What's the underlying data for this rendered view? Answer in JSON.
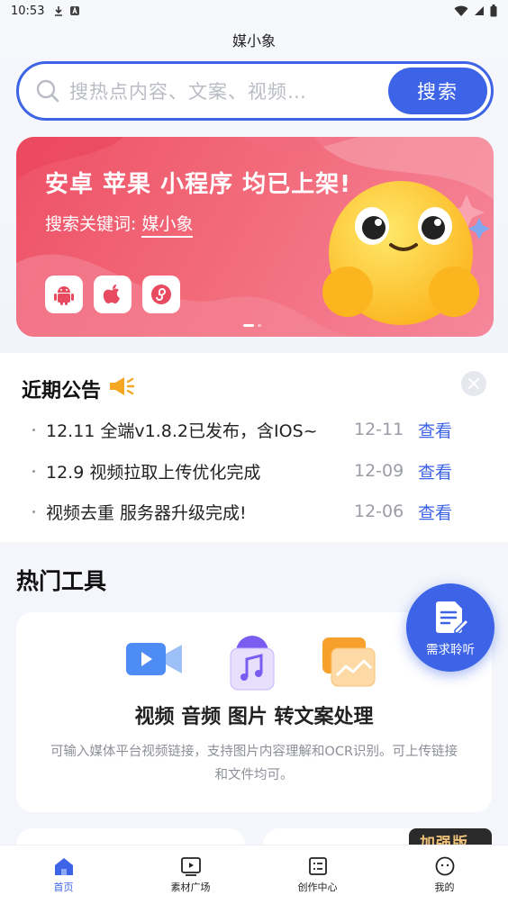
{
  "status_bar": {
    "time": "10:53"
  },
  "header": {
    "title": "媒小象"
  },
  "search": {
    "placeholder": "搜热点内容、文案、视频…",
    "button_label": "搜索"
  },
  "banner": {
    "title": "安卓 苹果 小程序 均已上架!",
    "subtitle_prefix": "搜索关键词:",
    "keyword": "媒小象",
    "platform_icons": [
      "android-icon",
      "apple-icon",
      "mini-program-icon"
    ]
  },
  "announcements": {
    "title": "近期公告",
    "items": [
      {
        "text": "12.11 全端v1.8.2已发布，含IOS~",
        "date": "12-11",
        "action": "查看"
      },
      {
        "text": "12.9 视频拉取上传优化完成",
        "date": "12-09",
        "action": "查看"
      },
      {
        "text": "视频去重 服务器升级完成!",
        "date": "12-06",
        "action": "查看"
      }
    ]
  },
  "hot_tools": {
    "title": "热门工具",
    "card_title": "视频 音频 图片 转文案处理",
    "card_desc": "可输入媒体平台视频链接，支持图片内容理解和OCR识别。可上传链接和文件均可。",
    "peek_badge": "加强版"
  },
  "fab": {
    "label": "需求聆听"
  },
  "bottom_nav": {
    "items": [
      {
        "label": "首页",
        "icon": "home-icon",
        "active": true
      },
      {
        "label": "素材广场",
        "icon": "video-square-icon",
        "active": false
      },
      {
        "label": "创作中心",
        "icon": "checklist-icon",
        "active": false
      },
      {
        "label": "我的",
        "icon": "smile-icon",
        "active": false
      }
    ]
  },
  "colors": {
    "accent": "#3d63e6",
    "banner": "#ee5167"
  }
}
